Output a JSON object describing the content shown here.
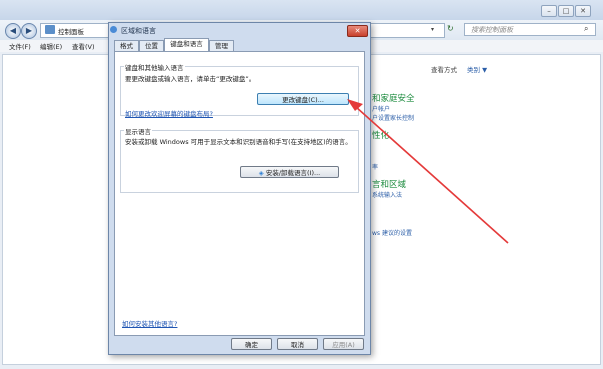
{
  "window": {
    "breadcrumb_root": "控制面板",
    "search_placeholder": "搜索控制面板",
    "menu": [
      "文件(F)",
      "编辑(E)",
      "查看(V)"
    ],
    "view_by_label": "查看方式",
    "view_by_value": "类别 ▼",
    "buttons": {
      "minimize": "–",
      "maximize": "□",
      "close": "✕"
    }
  },
  "control_panel": {
    "sections": [
      {
        "heading": "和家庭安全",
        "links": [
          "户帐户",
          "户设置家长控制"
        ]
      },
      {
        "heading": "性化",
        "links": [
          "",
          "率"
        ]
      },
      {
        "heading": "言和区域",
        "links": [
          "系统输入法",
          ""
        ]
      }
    ],
    "extra_link": "ws 建议的设置"
  },
  "dialog": {
    "title": "区域和语言",
    "tabs": [
      "格式",
      "位置",
      "键盘和语言",
      "管理"
    ],
    "active_tab_index": 2,
    "keyboard_group": {
      "label": "键盘和其他输入语言",
      "description": "要更改键盘或输入语言，请单击“更改键盘”。",
      "button": "更改键盘(C)...",
      "link": "如何更改欢迎屏幕的键盘布局?"
    },
    "display_group": {
      "label": "显示语言",
      "description": "安装或卸载 Windows 可用于显示文本和识别语音和手写(在支持地区)的语言。",
      "button": "安装/卸载语言(I)..."
    },
    "bottom_link": "如何安装其他语言?",
    "footer": {
      "ok": "确定",
      "cancel": "取消",
      "apply": "应用(A)"
    }
  },
  "annotation": {
    "arrow_color": "#e43a3a"
  }
}
